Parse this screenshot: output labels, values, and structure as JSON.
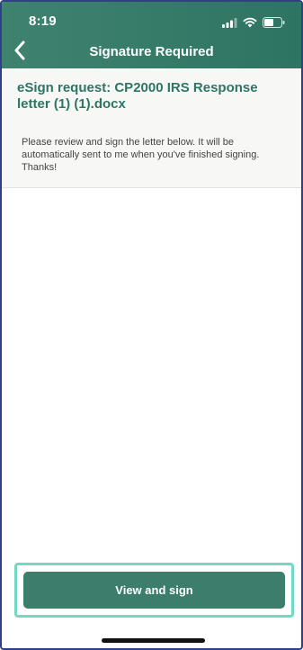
{
  "status_bar": {
    "time": "8:19",
    "icons": [
      "cellular-signal-icon",
      "wifi-icon",
      "battery-icon"
    ]
  },
  "nav": {
    "title": "Signature Required",
    "back_icon": "chevron-left-icon"
  },
  "request": {
    "title": "eSign request: CP2000 IRS Response letter (1) (1).docx",
    "message": "Please review and sign the letter below. It will be automatically sent to me when you've finished signing. Thanks!"
  },
  "actions": {
    "view_and_sign_label": "View and sign"
  },
  "colors": {
    "header_green": "#3f826f",
    "title_green": "#2e7563",
    "button_green": "#3c7d6c",
    "highlight_outline": "#72d8c3"
  }
}
